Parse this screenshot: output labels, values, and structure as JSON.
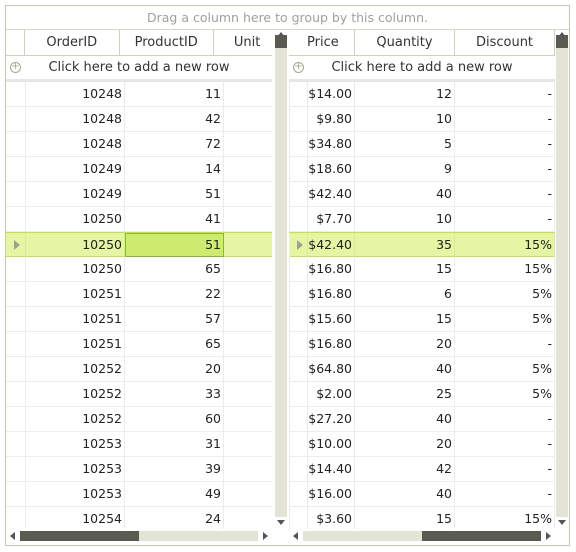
{
  "group_panel": {
    "text": "Drag a column here to group by this column."
  },
  "add_new_row": {
    "text": "Click here to add a new row",
    "icon": "plus-circle-icon"
  },
  "left_pane": {
    "columns": [
      "OrderID",
      "ProductID",
      "Unit"
    ],
    "rows": [
      [
        "10248",
        "11",
        ""
      ],
      [
        "10248",
        "42",
        ""
      ],
      [
        "10248",
        "72",
        ""
      ],
      [
        "10249",
        "14",
        ""
      ],
      [
        "10249",
        "51",
        ""
      ],
      [
        "10250",
        "41",
        ""
      ],
      [
        "10250",
        "51",
        ""
      ],
      [
        "10250",
        "65",
        ""
      ],
      [
        "10251",
        "22",
        ""
      ],
      [
        "10251",
        "57",
        ""
      ],
      [
        "10251",
        "65",
        ""
      ],
      [
        "10252",
        "20",
        ""
      ],
      [
        "10252",
        "33",
        ""
      ],
      [
        "10252",
        "60",
        ""
      ],
      [
        "10253",
        "31",
        ""
      ],
      [
        "10253",
        "39",
        ""
      ],
      [
        "10253",
        "49",
        ""
      ],
      [
        "10254",
        "24",
        ""
      ]
    ]
  },
  "right_pane": {
    "columns": [
      "Price",
      "Quantity",
      "Discount"
    ],
    "rows": [
      [
        "$14.00",
        "12",
        "-"
      ],
      [
        "$9.80",
        "10",
        "-"
      ],
      [
        "$34.80",
        "5",
        "-"
      ],
      [
        "$18.60",
        "9",
        "-"
      ],
      [
        "$42.40",
        "40",
        "-"
      ],
      [
        "$7.70",
        "10",
        "-"
      ],
      [
        "$42.40",
        "35",
        "15%"
      ],
      [
        "$16.80",
        "15",
        "15%"
      ],
      [
        "$16.80",
        "6",
        "5%"
      ],
      [
        "$15.60",
        "15",
        "5%"
      ],
      [
        "$16.80",
        "20",
        "-"
      ],
      [
        "$64.80",
        "40",
        "5%"
      ],
      [
        "$2.00",
        "25",
        "5%"
      ],
      [
        "$27.20",
        "40",
        "-"
      ],
      [
        "$10.00",
        "20",
        "-"
      ],
      [
        "$14.40",
        "42",
        "-"
      ],
      [
        "$16.00",
        "40",
        "-"
      ],
      [
        "$3.60",
        "15",
        "15%"
      ]
    ]
  },
  "selection": {
    "row_index": 6,
    "current_column": "ProductID"
  },
  "scroll": {
    "left_horizontal_position": 0.0,
    "right_horizontal_position": 1.0,
    "horizontal_thumb_fraction": 0.5,
    "vertical_position": 0.0
  },
  "colors": {
    "selected_row": "#e4f5a4",
    "current_cell": "#cdeb6e",
    "scroll_thumb": "#5a5a52",
    "scroll_track": "#e4e4d6"
  }
}
